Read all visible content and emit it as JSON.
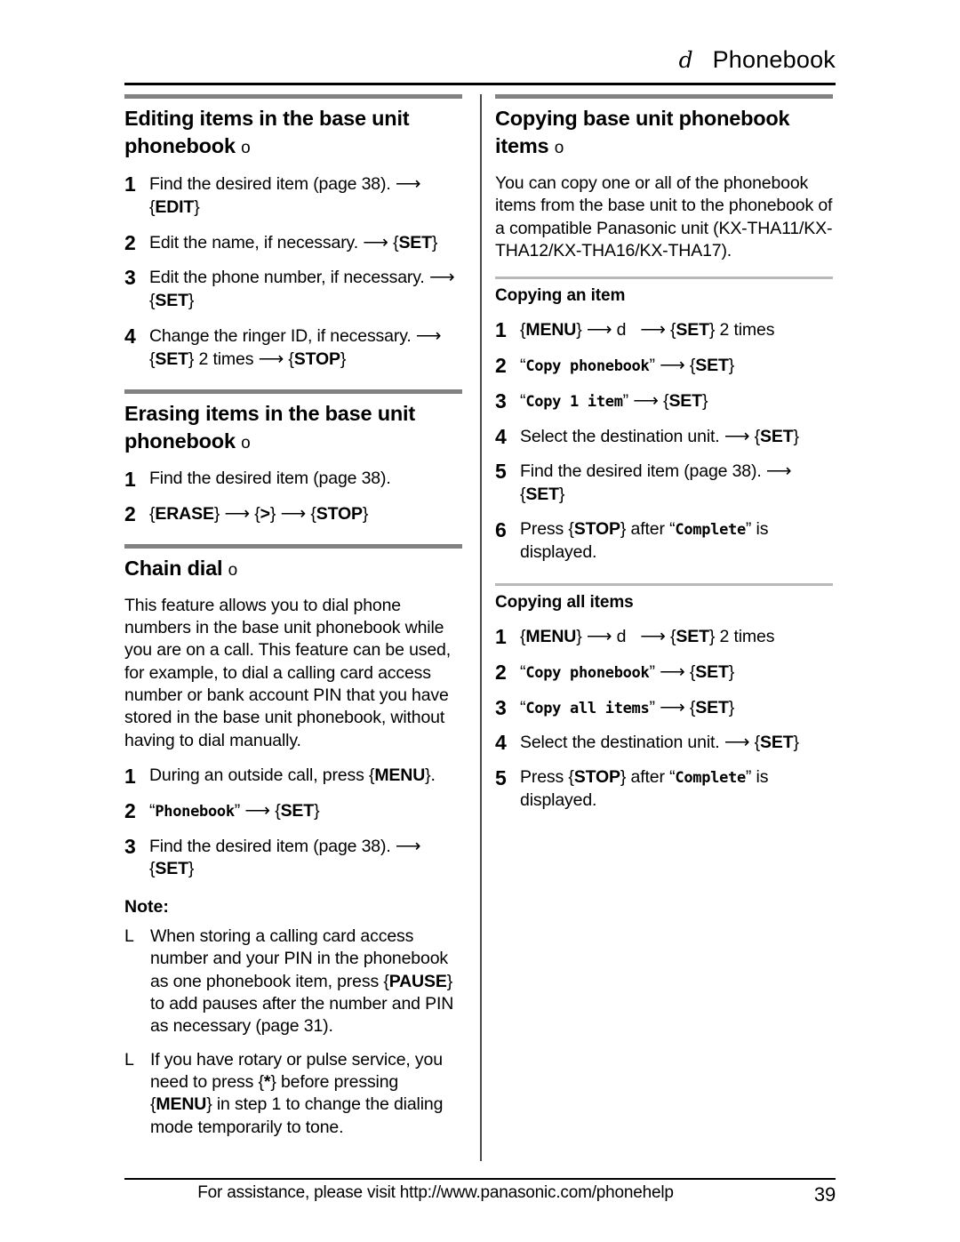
{
  "header": {
    "icon_glyph": "d",
    "icon_name": "phonebook-symbol",
    "title": "Phonebook"
  },
  "colors": {
    "section_rule": "#828282",
    "subsection_rule": "#b9b9b9",
    "text": "#000000",
    "divider": "#4a4a4a"
  },
  "left_column": {
    "sections": [
      {
        "title": "Editing items in the base unit phonebook",
        "title_marker": "o",
        "steps": [
          {
            "num": "1",
            "html": "Find the desired item (page 38). <span class=\"arrow\">&#10230;</span> <span class=\"brace\">{</span><span class=\"key\">EDIT</span><span class=\"brace\">}</span>"
          },
          {
            "num": "2",
            "html": "Edit the name, if necessary. <span class=\"arrow\">&#10230;</span> <span class=\"brace\">{</span><span class=\"key\">SET</span><span class=\"brace\">}</span>"
          },
          {
            "num": "3",
            "html": "Edit the phone number, if necessary. <span class=\"arrow\">&#10230;</span> <span class=\"brace\">{</span><span class=\"key\">SET</span><span class=\"brace\">}</span>"
          },
          {
            "num": "4",
            "html": "Change the ringer ID, if necessary. <span class=\"arrow\">&#10230;</span> <span class=\"brace\">{</span><span class=\"key\">SET</span><span class=\"brace\">}</span> 2 times <span class=\"arrow\">&#10230;</span> <span class=\"brace\">{</span><span class=\"key\">STOP</span><span class=\"brace\">}</span>"
          }
        ]
      },
      {
        "title": "Erasing items in the base unit phonebook",
        "title_marker": "o",
        "steps": [
          {
            "num": "1",
            "html": "Find the desired item (page 38)."
          },
          {
            "num": "2",
            "html": "<span class=\"brace\">{</span><span class=\"key\">ERASE</span><span class=\"brace\">}</span> <span class=\"arrow\">&#10230;</span> <span class=\"brace\">{</span><span class=\"key\">&gt;</span><span class=\"brace\">}</span> <span class=\"arrow\">&#10230;</span> <span class=\"brace\">{</span><span class=\"key\">STOP</span><span class=\"brace\">}</span>"
          }
        ]
      },
      {
        "title": "Chain dial",
        "title_marker": "o",
        "paragraph": "This feature allows you to dial phone numbers in the base unit phonebook while you are on a call. This feature can be used, for example, to dial a calling card access number or bank account PIN that you have stored in the base unit phonebook, without having to dial manually.",
        "steps": [
          {
            "num": "1",
            "html": "During an outside call, press <span class=\"brace\">{</span><span class=\"key\">MENU</span><span class=\"brace\">}</span>."
          },
          {
            "num": "2",
            "html": "&#8220;<span class=\"disp\">Phonebook</span>&#8221; <span class=\"arrow\">&#10230;</span> <span class=\"brace\">{</span><span class=\"key\">SET</span><span class=\"brace\">}</span>"
          },
          {
            "num": "3",
            "html": "Find the desired item (page 38). <span class=\"arrow\">&#10230;</span> <span class=\"brace\">{</span><span class=\"key\">SET</span><span class=\"brace\">}</span>"
          }
        ],
        "note_heading": "Note:",
        "notes": [
          {
            "bullet": "L",
            "html": "When storing a calling card access number and your PIN in the phonebook as one phonebook item, press <span class=\"brace\">{</span><span class=\"key\">PAUSE</span><span class=\"brace\">}</span> to add pauses after the number and PIN as necessary (page 31)."
          },
          {
            "bullet": "L",
            "html": "If you have rotary or pulse service, you need to press <span class=\"brace\">{</span><span class=\"key\">*</span><span class=\"brace\">}</span> before pressing <span class=\"brace\">{</span><span class=\"key\">MENU</span><span class=\"brace\">}</span> in step 1 to change the dialing mode temporarily to tone."
          }
        ]
      }
    ]
  },
  "right_column": {
    "section": {
      "title": "Copying base unit phonebook items",
      "title_marker": "o",
      "paragraph": "You can copy one or all of the phonebook items from the base unit to the phonebook of a compatible Panasonic unit (KX-THA11/KX-THA12/KX-THA16/KX-THA17).",
      "subsections": [
        {
          "title": "Copying an item",
          "steps": [
            {
              "num": "1",
              "html": "<span class=\"brace\">{</span><span class=\"key\">MENU</span><span class=\"brace\">}</span> <span class=\"arrow\">&#10230;</span> <span class=\"sym-d\">d</span> &nbsp;&nbsp;<span class=\"arrow\">&#10230;</span> <span class=\"brace\">{</span><span class=\"key\">SET</span><span class=\"brace\">}</span> 2 times"
            },
            {
              "num": "2",
              "html": "&#8220;<span class=\"disp\">Copy phonebook</span>&#8221; <span class=\"arrow\">&#10230;</span> <span class=\"brace\">{</span><span class=\"key\">SET</span><span class=\"brace\">}</span>"
            },
            {
              "num": "3",
              "html": "&#8220;<span class=\"disp\">Copy 1 item</span>&#8221; <span class=\"arrow\">&#10230;</span> <span class=\"brace\">{</span><span class=\"key\">SET</span><span class=\"brace\">}</span>"
            },
            {
              "num": "4",
              "html": "Select the destination unit. <span class=\"arrow\">&#10230;</span> <span class=\"brace\">{</span><span class=\"key\">SET</span><span class=\"brace\">}</span>"
            },
            {
              "num": "5",
              "html": "Find the desired item (page 38). <span class=\"arrow\">&#10230;</span> <span class=\"brace\">{</span><span class=\"key\">SET</span><span class=\"brace\">}</span>"
            },
            {
              "num": "6",
              "html": "Press <span class=\"brace\">{</span><span class=\"key\">STOP</span><span class=\"brace\">}</span> after &#8220;<span class=\"disp\">Complete</span>&#8221; is displayed."
            }
          ]
        },
        {
          "title": "Copying all items",
          "steps": [
            {
              "num": "1",
              "html": "<span class=\"brace\">{</span><span class=\"key\">MENU</span><span class=\"brace\">}</span> <span class=\"arrow\">&#10230;</span> <span class=\"sym-d\">d</span> &nbsp;&nbsp;<span class=\"arrow\">&#10230;</span> <span class=\"brace\">{</span><span class=\"key\">SET</span><span class=\"brace\">}</span> 2 times"
            },
            {
              "num": "2",
              "html": "&#8220;<span class=\"disp\">Copy phonebook</span>&#8221; <span class=\"arrow\">&#10230;</span> <span class=\"brace\">{</span><span class=\"key\">SET</span><span class=\"brace\">}</span>"
            },
            {
              "num": "3",
              "html": "&#8220;<span class=\"disp\">Copy all items</span>&#8221; <span class=\"arrow\">&#10230;</span> <span class=\"brace\">{</span><span class=\"key\">SET</span><span class=\"brace\">}</span>"
            },
            {
              "num": "4",
              "html": "Select the destination unit. <span class=\"arrow\">&#10230;</span> <span class=\"brace\">{</span><span class=\"key\">SET</span><span class=\"brace\">}</span>"
            },
            {
              "num": "5",
              "html": "Press <span class=\"brace\">{</span><span class=\"key\">STOP</span><span class=\"brace\">}</span> after &#8220;<span class=\"disp\">Complete</span>&#8221; is displayed."
            }
          ]
        }
      ]
    }
  },
  "footer": {
    "text": "For assistance, please visit http://www.panasonic.com/phonehelp",
    "page_number": "39"
  }
}
